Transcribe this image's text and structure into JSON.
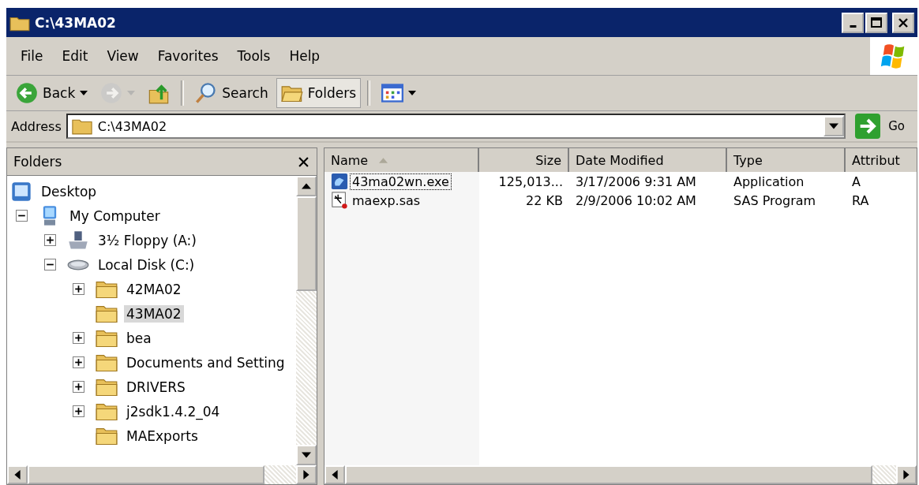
{
  "window": {
    "title": "C:\\43MA02"
  },
  "menu": [
    {
      "label": "File"
    },
    {
      "label": "Edit"
    },
    {
      "label": "View"
    },
    {
      "label": "Favorites"
    },
    {
      "label": "Tools"
    },
    {
      "label": "Help"
    }
  ],
  "toolbar": [
    {
      "kind": "back",
      "label": "Back",
      "disabled": false,
      "selected": false
    },
    {
      "kind": "forward",
      "disabled": true,
      "selected": false
    },
    {
      "kind": "up",
      "disabled": false,
      "selected": false
    },
    {
      "kind": "search",
      "label": "Search",
      "disabled": false,
      "selected": false
    },
    {
      "kind": "folders",
      "label": "Folders",
      "disabled": false,
      "selected": true
    },
    {
      "kind": "views",
      "disabled": false,
      "selected": false
    }
  ],
  "address": {
    "label": "Address",
    "value": "C:\\43MA02",
    "go": "Go"
  },
  "folders_pane": {
    "title": "Folders",
    "tree": [
      {
        "label": "Desktop",
        "kind": "desktop",
        "selected": false,
        "children": [
          {
            "label": "My Computer",
            "kind": "computer",
            "selected": false,
            "expanded": true,
            "children": [
              {
                "label": "3½ Floppy (A:)",
                "kind": "floppy",
                "selected": false,
                "expanded": false
              },
              {
                "label": "Local Disk (C:)",
                "kind": "drive",
                "selected": false,
                "expanded": true,
                "children": [
                  {
                    "label": "42MA02",
                    "kind": "folder",
                    "selected": false,
                    "expanded": false
                  },
                  {
                    "label": "43MA02",
                    "kind": "folder",
                    "selected": true
                  },
                  {
                    "label": "bea",
                    "kind": "folder",
                    "selected": false,
                    "expanded": false
                  },
                  {
                    "label": "Documents and Setting",
                    "kind": "folder",
                    "selected": false,
                    "expanded": false
                  },
                  {
                    "label": "DRIVERS",
                    "kind": "folder",
                    "selected": false,
                    "expanded": false
                  },
                  {
                    "label": "j2sdk1.4.2_04",
                    "kind": "folder",
                    "selected": false,
                    "expanded": false
                  },
                  {
                    "label": "MAExports",
                    "kind": "folder",
                    "selected": false
                  }
                ]
              }
            ]
          }
        ]
      }
    ]
  },
  "file_list": {
    "columns": [
      {
        "label": "Name",
        "sorted_ascending": true
      },
      {
        "label": "Size"
      },
      {
        "label": "Date Modified"
      },
      {
        "label": "Type"
      },
      {
        "label": "Attribut"
      }
    ],
    "rows": [
      {
        "kind": "exe",
        "focused": true,
        "cells": [
          "43ma02wn.exe",
          "125,013...",
          "3/17/2006 9:31 AM",
          "Application",
          "A"
        ]
      },
      {
        "kind": "sas",
        "focused": false,
        "cells": [
          "maexp.sas",
          "22 KB",
          "2/9/2006 10:02 AM",
          "SAS Program",
          "RA"
        ]
      }
    ]
  }
}
